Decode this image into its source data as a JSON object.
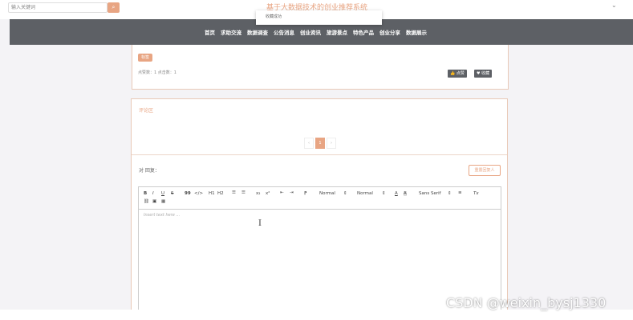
{
  "header": {
    "search_placeholder": "输入关键词",
    "search_icon": "search-icon",
    "site_title": "基于大数据技术的创业推荐系统",
    "toast": "收藏成功"
  },
  "nav": {
    "items": [
      "首页",
      "求助交流",
      "数据调查",
      "公告消息",
      "创业资讯",
      "旅游景点",
      "特色产品",
      "创业分享",
      "数据展示"
    ]
  },
  "post": {
    "tag": "标签",
    "counts": "点赞数：1   点击数：1",
    "like_button": "点赞",
    "favorite_button": "收藏"
  },
  "comments": {
    "title": "评论区",
    "pager": {
      "prev": "‹",
      "current": "1",
      "next": "›"
    },
    "reply_label": "对 回复：",
    "reset_button": "重置回复人",
    "editor": {
      "toolbar": {
        "bold": "B",
        "italic": "I",
        "underline": "U",
        "strike": "S",
        "quote": "99",
        "code": "</>",
        "h1": "H1",
        "h2": "H2",
        "ordered_list": "☰",
        "bullet_list": "☰",
        "subscript": "x₂",
        "superscript": "x²",
        "outdent": "⇤",
        "indent": "⇥",
        "direction": "⁋",
        "size": "Normal",
        "header": "Normal",
        "color": "A",
        "background": "A",
        "font": "Sans Serif",
        "align": "≡",
        "clean": "Tx",
        "link": "🔗",
        "image": "▣",
        "video": "▦"
      },
      "placeholder": "Insert text here ..."
    }
  },
  "watermark": "CSDN @weixin_bysj1330",
  "colors": {
    "accent": "#e8a583",
    "nav_bg": "#5d6065",
    "page_bg": "#f4f3f6"
  }
}
